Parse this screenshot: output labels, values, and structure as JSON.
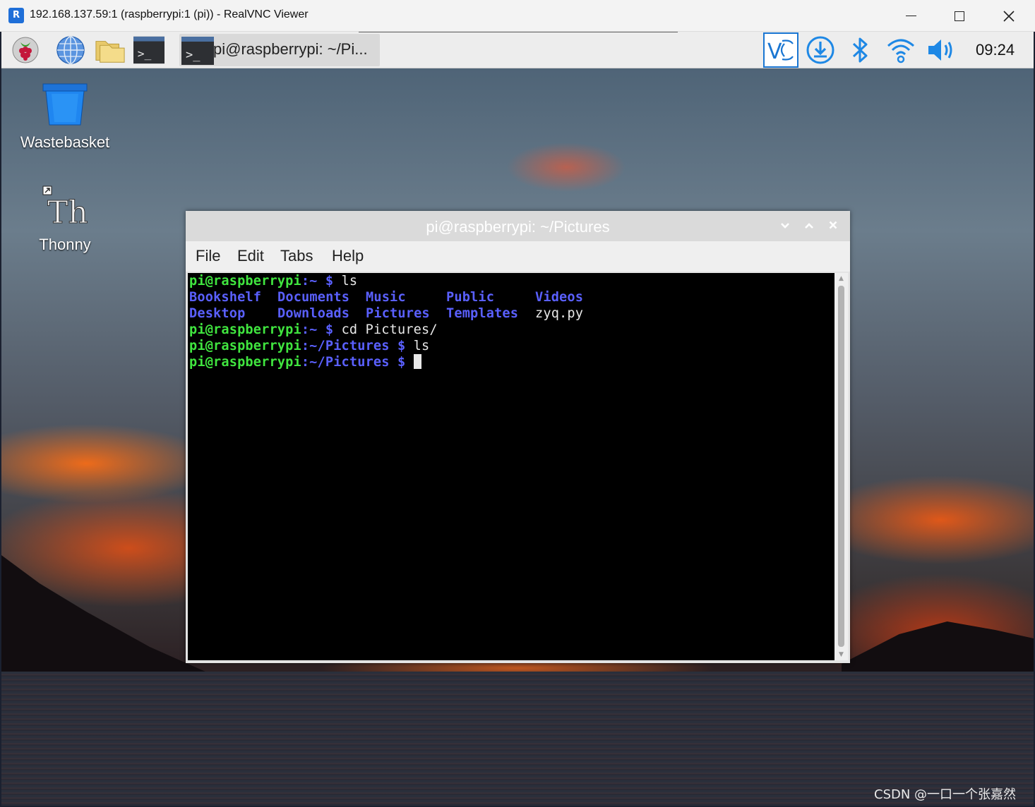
{
  "vnc": {
    "title": "192.168.137.59:1 (raspberrypi:1 (pi)) - RealVNC Viewer",
    "app_icon_text": "R"
  },
  "taskbar": {
    "task_button_label": "pi@raspberrypi: ~/Pi...",
    "clock": "09:24",
    "icons": [
      "raspberry-menu-icon",
      "web-browser-icon",
      "file-manager-icon",
      "terminal-icon",
      "vnc-server-icon",
      "updater-icon",
      "bluetooth-icon",
      "wifi-icon",
      "volume-icon"
    ]
  },
  "desktop": {
    "items": [
      {
        "label": "Wastebasket",
        "icon": "wastebasket-icon"
      },
      {
        "label": "Thonny",
        "icon": "thonny-icon"
      }
    ]
  },
  "terminal": {
    "title": "pi@raspberrypi: ~/Pictures",
    "menu": [
      "File",
      "Edit",
      "Tabs",
      "Help"
    ],
    "lines": [
      {
        "prompt_user": "pi@raspberrypi",
        "prompt_path": ":~",
        "prompt_sign": " $",
        "command": " ls"
      },
      {
        "listing": [
          "Bookshelf",
          "Documents",
          "Music",
          "Public",
          "Videos"
        ]
      },
      {
        "listing": [
          "Desktop",
          "Downloads",
          "Pictures",
          "Templates",
          "zyq.py"
        ]
      },
      {
        "prompt_user": "pi@raspberrypi",
        "prompt_path": ":~",
        "prompt_sign": " $",
        "command": " cd Pictures/"
      },
      {
        "prompt_user": "pi@raspberrypi",
        "prompt_path": ":~/Pictures",
        "prompt_sign": " $",
        "command": " ls"
      },
      {
        "prompt_user": "pi@raspberrypi",
        "prompt_path": ":~/Pictures",
        "prompt_sign": " $",
        "command": " "
      }
    ]
  },
  "watermark": "CSDN @一口一个张嘉然",
  "colors": {
    "prompt_green": "#40e53f",
    "directory_blue": "#5a60ff",
    "terminal_bg": "#000000"
  }
}
